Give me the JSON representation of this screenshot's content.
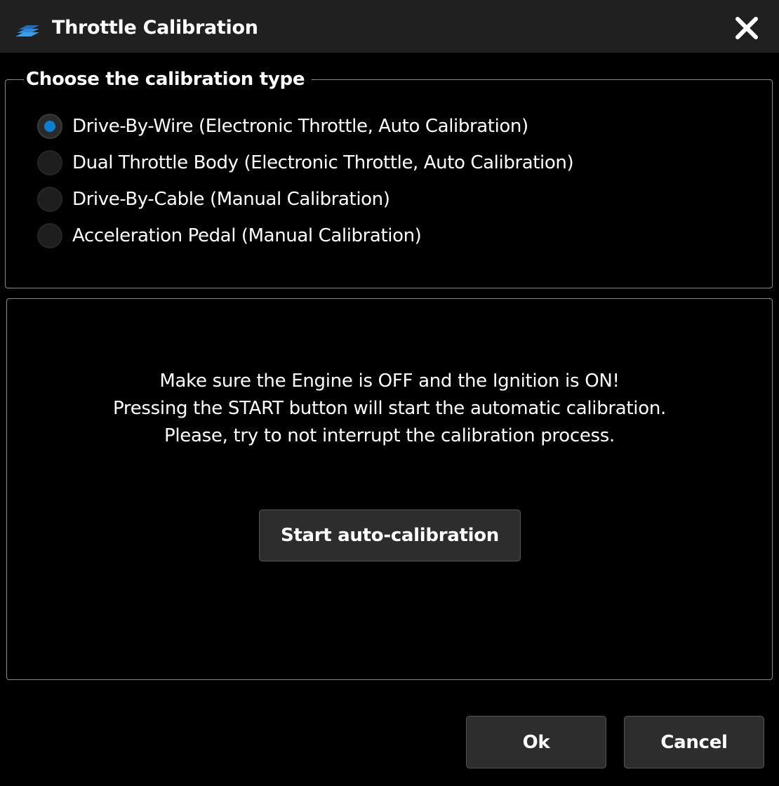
{
  "window": {
    "title": "Throttle Calibration",
    "app_icon": "app-logo-icon",
    "close_icon": "close-icon"
  },
  "calibration_type": {
    "legend": "Choose the calibration type",
    "selected": 0,
    "options": [
      {
        "label": "Drive-By-Wire (Electronic Throttle, Auto Calibration)",
        "checked": true
      },
      {
        "label": "Dual Throttle Body (Electronic Throttle, Auto Calibration)",
        "checked": false
      },
      {
        "label": "Drive-By-Cable (Manual Calibration)",
        "checked": false
      },
      {
        "label": "Acceleration Pedal (Manual Calibration)",
        "checked": false
      }
    ]
  },
  "panel": {
    "instructions": [
      "Make sure the Engine is OFF and the Ignition is ON!",
      "Pressing the START button will start the automatic calibration.",
      "Please, try to not interrupt the calibration process."
    ],
    "start_button": "Start auto-calibration"
  },
  "footer": {
    "ok_button": "Ok",
    "cancel_button": "Cancel"
  },
  "colors": {
    "accent": "#0a7fd6",
    "titlebar": "#202020",
    "background": "#000000",
    "button": "#2d2d2d",
    "border": "#8a8a8a"
  }
}
